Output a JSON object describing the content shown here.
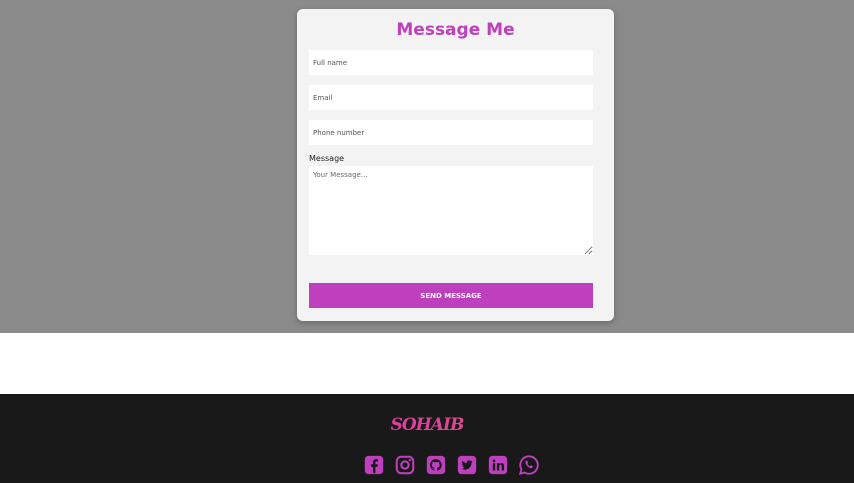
{
  "form": {
    "title": "Message Me",
    "full_name_placeholder": "Full name",
    "email_placeholder": "Email",
    "phone_placeholder": "Phone number",
    "message_label": "Message",
    "message_placeholder": "Your Message...",
    "send_label": "SEND MESSAGE"
  },
  "footer": {
    "logo_text": "SOHAIB",
    "socials": [
      "facebook-icon",
      "instagram-icon",
      "github-icon",
      "twitter-icon",
      "linkedin-icon",
      "whatsapp-icon"
    ],
    "icon_color": "#bf40bf"
  },
  "colors": {
    "accent": "#bf40bf",
    "overlay": "#8a8a8a",
    "footer_bg": "#1a191a"
  }
}
